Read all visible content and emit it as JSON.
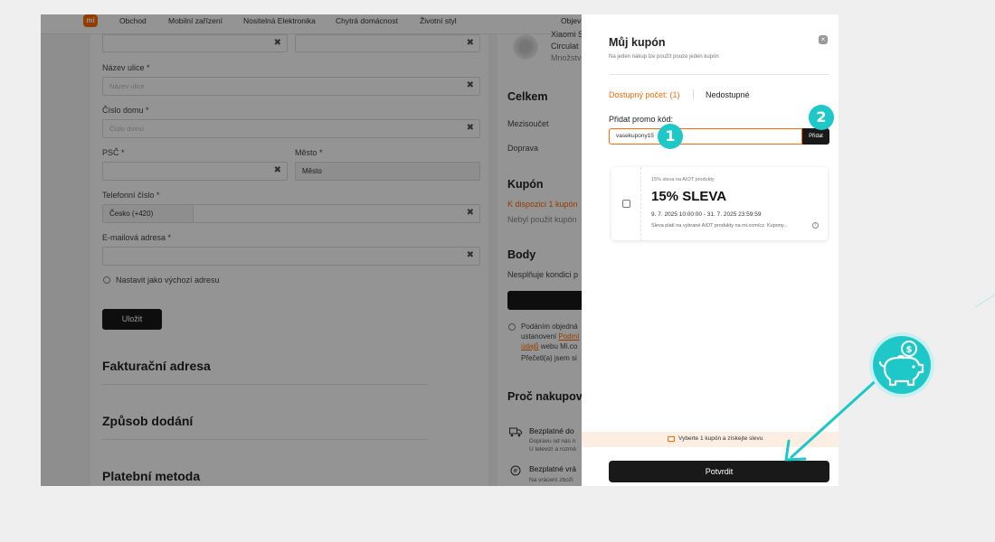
{
  "nav": {
    "logo": "mi",
    "items": [
      "Obchod",
      "Mobilní zařízení",
      "Nositelná Elektronika",
      "Chytrá domácnost",
      "Životní styl",
      "Objev"
    ]
  },
  "address_form": {
    "street_label": "Název ulice *",
    "street_placeholder": "Název ulice",
    "house_label": "Číslo domu *",
    "house_placeholder": "Číslo domu",
    "zip_label": "PSČ *",
    "city_label": "Město *",
    "city_value": "Město",
    "phone_label": "Telefonní číslo *",
    "phone_prefix": "Česko (+420)",
    "email_label": "E-mailová adresa *",
    "default_checkbox": "Nastavit jako výchozí adresu",
    "save_button": "Uložit",
    "clear_glyph": "✖"
  },
  "sections": {
    "billing": "Fakturační adresa",
    "delivery": "Způsob dodání",
    "payment": "Platební metoda"
  },
  "summary": {
    "product_name_1": "Xiaomi S",
    "product_name_2": "Circulat",
    "product_qty": "Množstv",
    "total_title": "Celkem",
    "subtotal": "Mezisoučet",
    "shipping": "Doprava",
    "coupon_title": "Kupón",
    "coupon_available": "K dispozici 1 kupón",
    "coupon_unused": "Nebyl použit kupón",
    "points_title": "Body",
    "points_note": "Nesplňuje kondici p",
    "terms_1": "Podáním objedná",
    "terms_2a": "ustanovení ",
    "terms_2b": "Podmí",
    "terms_3a": "údajů",
    "terms_3b": " webu Mi.co",
    "terms_4": "Přečetl(a) jsem si",
    "why_title": "Proč nakupova",
    "benefit1_title": "Bezplatné do",
    "benefit1_line1": "Dopravu od nás n",
    "benefit1_line2": "U televizí a rozmě",
    "benefit2_title": "Bezplatné vrá",
    "benefit2_line1": "Na vrácení zboží"
  },
  "modal": {
    "title": "Můj kupón",
    "subtitle": "Na jeden nákup lze použít pouze jeden kupón",
    "tab_available": "Dostupný počet: (1)",
    "tab_unavailable": "Nedostupné",
    "promo_label": "Přidat promo kód:",
    "promo_value": "vasekupony15",
    "promo_button": "Přidat",
    "close_glyph": "×",
    "coupon": {
      "category": "15% sleva na AIOT produkty",
      "headline": "15% SLEVA",
      "validity": "9. 7. 2025 10:00:00 - 31. 7. 2025 23:59:59",
      "note": "Sleva platí na vybrané AIOT produkty na mi.com/cz. Kupony...",
      "info_glyph": "i"
    },
    "hint": "Vyberte 1 kupón a získejte slevu",
    "confirm_button": "Potvrdit"
  },
  "callouts": {
    "step1": "1",
    "step2": "2"
  },
  "colors": {
    "accent": "#ff6900",
    "callout": "#1ec8c8",
    "dark_button": "#191919"
  },
  "icons": {
    "close": "close-icon",
    "piggy": "piggy-bank-coin-icon",
    "truck": "truck-icon",
    "return": "return-icon"
  }
}
